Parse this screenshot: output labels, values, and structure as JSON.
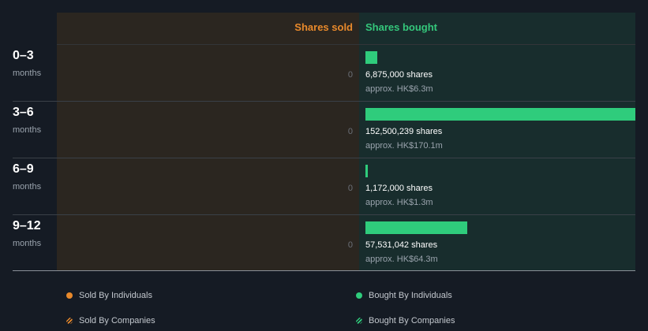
{
  "headers": {
    "sold": "Shares sold",
    "bought": "Shares bought"
  },
  "colors": {
    "sold": "#e8892b",
    "bought": "#2fcc7c",
    "sold_bg": "#2b2620",
    "bought_bg": "#182d2d"
  },
  "rows": [
    {
      "period": "0–3",
      "unit": "months",
      "sold": "0",
      "shares_label": "6,875,000 shares",
      "approx": "approx. HK$6.3m"
    },
    {
      "period": "3–6",
      "unit": "months",
      "sold": "0",
      "shares_label": "152,500,239 shares",
      "approx": "approx. HK$170.1m"
    },
    {
      "period": "6–9",
      "unit": "months",
      "sold": "0",
      "shares_label": "1,172,000 shares",
      "approx": "approx. HK$1.3m"
    },
    {
      "period": "9–12",
      "unit": "months",
      "sold": "0",
      "shares_label": "57,531,042 shares",
      "approx": "approx. HK$64.3m"
    }
  ],
  "legend": {
    "sold_individuals": "Sold By Individuals",
    "bought_individuals": "Bought By Individuals",
    "sold_companies": "Sold By Companies",
    "bought_companies": "Bought By Companies"
  },
  "chart_data": {
    "type": "bar",
    "categories": [
      "0–3",
      "3–6",
      "6–9",
      "9–12"
    ],
    "series": [
      {
        "name": "Shares sold",
        "values": [
          0,
          0,
          0,
          0
        ]
      },
      {
        "name": "Shares bought",
        "values": [
          6875000,
          152500239,
          1172000,
          57531042
        ]
      }
    ],
    "bought_value_hkd_m": [
      6.3,
      170.1,
      1.3,
      64.3
    ]
  }
}
